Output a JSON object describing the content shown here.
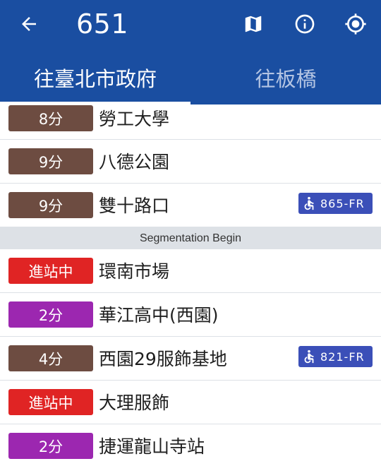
{
  "header": {
    "route": "651",
    "background": "#1a4ea1"
  },
  "tabs": [
    {
      "label": "往臺北市政府",
      "active": true
    },
    {
      "label": "往板橋",
      "active": false
    }
  ],
  "stops": [
    {
      "eta": "8分",
      "eta_color": "#6d4c41",
      "name": "勞工大學"
    },
    {
      "eta": "9分",
      "eta_color": "#6d4c41",
      "name": "八德公園"
    },
    {
      "eta": "9分",
      "eta_color": "#6d4c41",
      "name": "雙十路口",
      "bus": "865-FR"
    },
    {
      "segment": "Segmentation Begin"
    },
    {
      "eta": "進站中",
      "eta_color": "#e02424",
      "name": "環南市場"
    },
    {
      "eta": "2分",
      "eta_color": "#9c27b0",
      "name": "華江高中(西園)"
    },
    {
      "eta": "4分",
      "eta_color": "#6d4c41",
      "name": "西園29服飾基地",
      "bus": "821-FR"
    },
    {
      "eta": "進站中",
      "eta_color": "#e02424",
      "name": "大理服飾"
    },
    {
      "eta": "2分",
      "eta_color": "#9c27b0",
      "name": "捷運龍山寺站"
    }
  ],
  "icons": {
    "back": "arrow-back-icon",
    "map": "map-icon",
    "info": "info-icon",
    "location": "my-location-icon",
    "wheelchair": "wheelchair-icon"
  }
}
